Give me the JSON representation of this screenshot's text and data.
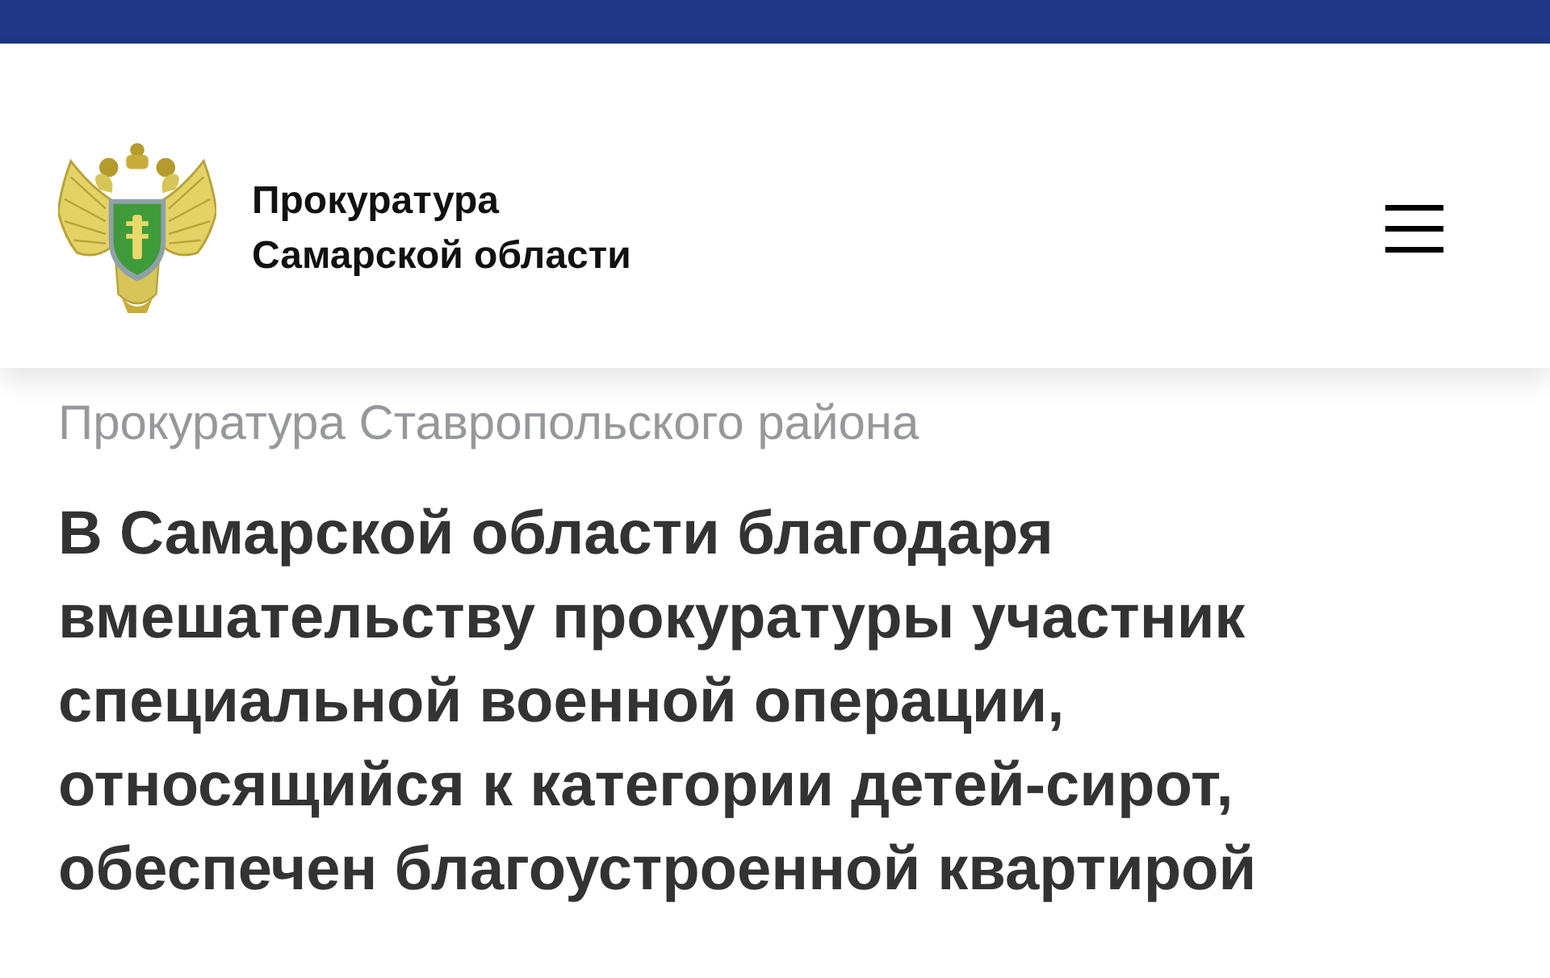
{
  "header": {
    "site_name": "Прокуратура Самарской области"
  },
  "breadcrumb": "Прокуратура Ставропольского района",
  "article": {
    "title": "В Самарской области благодаря вмешательству прокуратуры участник специальной военной операции, относящийся к категории детей-сирот, обеспечен благоустроенной квартирой"
  }
}
